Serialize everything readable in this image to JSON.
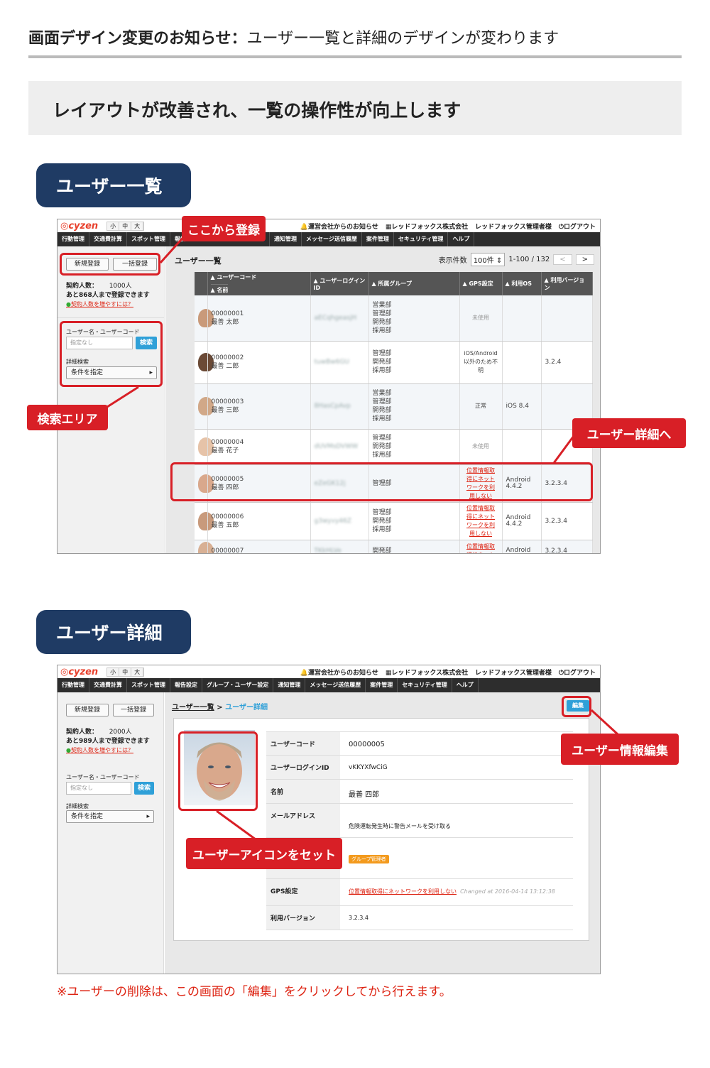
{
  "header": {
    "title_bold": "画面デザイン変更のお知らせ：",
    "title_rest": "ユーザー一覧と詳細のデザインが変わります"
  },
  "band": {
    "text": "レイアウトが改善され、一覧の操作性が向上します"
  },
  "sections": {
    "list": "ユーザー一覧",
    "detail": "ユーザー詳細"
  },
  "app": {
    "logo": "cyzen",
    "sizes": [
      "小",
      "中",
      "大"
    ],
    "notice": "運営会社からのお知らせ",
    "company": "レッドフォックス株式会社",
    "admin": "レッドフォックス管理者様",
    "logout": "ログアウト",
    "menu_list": [
      "行動管理",
      "交通費計算",
      "スポット管理",
      "報告",
      "",
      "",
      "通知管理",
      "メッセージ送信履歴",
      "案件管理",
      "セキュリティ管理",
      "ヘルプ"
    ],
    "menu_detail": [
      "行動管理",
      "交通費計算",
      "スポット管理",
      "報告設定",
      "グループ・ユーザー設定",
      "通知管理",
      "メッセージ送信履歴",
      "案件管理",
      "セキュリティ管理",
      "ヘルプ"
    ],
    "new_btn": "新規登録",
    "bulk_btn": "一括登録",
    "contract_label": "契約人数：",
    "list_contract": "1000人",
    "list_remaining": "あと868人まで登録できます",
    "detail_contract": "2000人",
    "detail_remaining": "あと989人まで登録できます",
    "increase_link": "契約人数を増やすには？",
    "search_label": "ユーザー名・ユーザーコード",
    "search_placeholder": "指定なし",
    "search_btn": "検索",
    "detail_search_label": "詳細検索",
    "condition_btn": "条件を指定"
  },
  "list": {
    "heading": "ユーザー一覧",
    "per_page_label": "表示件数",
    "per_page": "100件",
    "range": "1-100 / 132",
    "prev": "<",
    "next": ">",
    "columns": {
      "code": "ユーザーコード",
      "name": "名前",
      "login": "ユーザーログインID",
      "group": "所属グループ",
      "gps": "GPS設定",
      "os": "利用OS",
      "version": "利用バージョン"
    },
    "rows": [
      {
        "code": "00000001",
        "name": "最善 太郎",
        "login": "aECqhgeasjH",
        "groups": "営業部\n管理部\n開発部\n採用部",
        "gps": "未使用",
        "gps_link": false,
        "os": "",
        "version": "",
        "skin": "#c99a7a"
      },
      {
        "code": "00000002",
        "name": "最善 二郎",
        "login": "tuwBw6GU",
        "groups": "管理部\n開発部\n採用部",
        "gps": "iOS/Android\n以外のため不\n明",
        "gps_link": false,
        "os": "",
        "version": "3.2.4",
        "skin": "#6b4a36"
      },
      {
        "code": "00000003",
        "name": "最善 三郎",
        "login": "8HasCpAvp",
        "groups": "営業部\n管理部\n開発部\n採用部",
        "gps": "正常",
        "gps_link": false,
        "os": "iOS 8.4",
        "version": "",
        "skin": "#d1a888"
      },
      {
        "code": "00000004",
        "name": "最善 花子",
        "login": "dUVMsDVWW",
        "groups": "管理部\n開発部\n採用部",
        "gps": "未使用",
        "gps_link": false,
        "os": "",
        "version": "",
        "skin": "#e6c3a8"
      },
      {
        "code": "00000005",
        "name": "最善 四郎",
        "login": "eZeGK12j",
        "groups": "管理部",
        "gps": "位置情報取\n得にネット\nワークを利\n用しない",
        "gps_link": true,
        "os": "Android\n4.4.2",
        "version": "3.2.3.4",
        "skin": "#d9a88c"
      },
      {
        "code": "00000006",
        "name": "最善 五郎",
        "login": "g3wyvy46Z",
        "groups": "管理部\n開発部\n採用部",
        "gps": "位置情報取\n得にネット\nワークを利\n用しない",
        "gps_link": true,
        "os": "Android\n4.4.2",
        "version": "3.2.3.4",
        "skin": "#c89a7c"
      },
      {
        "code": "00000007",
        "name": "",
        "login": "TKkHLVe",
        "groups": "開発部",
        "gps": "位置情報取\n得にネット",
        "gps_link": true,
        "os": "Android",
        "version": "3.2.3.4",
        "skin": "#d8b094"
      }
    ]
  },
  "detail": {
    "breadcrumb_parent": "ユーザー一覧",
    "breadcrumb_sep": " > ",
    "breadcrumb_current": "ユーザー詳細",
    "edit_btn": "編集",
    "fields": {
      "code_label": "ユーザーコード",
      "code": "00000005",
      "login_label": "ユーザーログインID",
      "login": "vKKYXfwCiG",
      "name_label": "名前",
      "name": "最善 四郎",
      "mail_label": "メールアドレス",
      "mail_alert": "危険運転発生時に警告メールを受け取る",
      "badge": "グループ管理者",
      "gps_label": "GPS設定",
      "gps": "位置情報取得にネットワークを利用しない",
      "gps_changed": "Changed at 2016-04-14 13:12:38",
      "version_label": "利用バージョン",
      "version": "3.2.3.4"
    }
  },
  "callouts": {
    "register": "ここから登録",
    "search": "検索エリア",
    "to_detail": "ユーザー詳細へ",
    "edit": "ユーザー情報編集",
    "icon": "ユーザーアイコンをセット"
  },
  "note": "※ユーザーの削除は、この画面の「編集」をクリックしてから行えます。",
  "colors": {
    "accent_red": "#d81f26",
    "navy": "#1f3b64",
    "link_blue": "#2fa0d8"
  }
}
